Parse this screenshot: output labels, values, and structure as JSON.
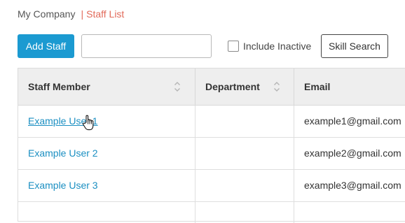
{
  "breadcrumb": {
    "home": "My Company",
    "separator": "|",
    "current": "Staff List"
  },
  "toolbar": {
    "add_staff_label": "Add Staff",
    "search_value": "",
    "include_inactive_label": "Include Inactive",
    "include_inactive_checked": false,
    "skill_search_label": "Skill Search"
  },
  "table": {
    "columns": [
      {
        "label": "Staff Member",
        "sortable": true
      },
      {
        "label": "Department",
        "sortable": true
      },
      {
        "label": "Email",
        "sortable": false
      }
    ],
    "rows": [
      {
        "name": "Example User 1",
        "department": "",
        "email": "example1@gmail.com",
        "hovered": true
      },
      {
        "name": "Example User 2",
        "department": "",
        "email": "example2@gmail.com"
      },
      {
        "name": "Example User 3",
        "department": "",
        "email": "example3@gmail.com"
      }
    ]
  },
  "colors": {
    "primary_button": "#1b9ad1",
    "link": "#1b8fc2",
    "breadcrumb_active": "#e26a5a",
    "header_bg": "#eeeeee"
  },
  "icons": {
    "sort": "sort-updown-icon",
    "cursor": "hand-pointer-cursor-icon"
  }
}
